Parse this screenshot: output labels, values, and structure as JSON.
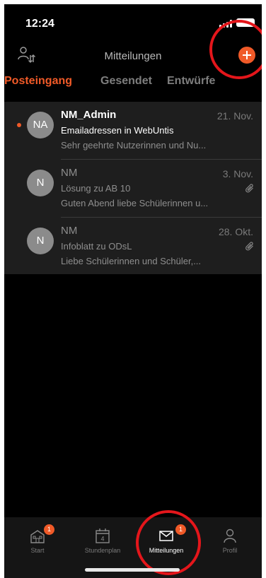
{
  "status_bar": {
    "time": "12:24"
  },
  "header": {
    "title": "Mitteilungen",
    "sort_icon": "sort-person-icon",
    "compose_icon": "plus-icon"
  },
  "tabs": [
    {
      "label": "Posteingang",
      "active": true
    },
    {
      "label": "Gesendet",
      "active": false
    },
    {
      "label": "Entwürfe",
      "active": false
    }
  ],
  "messages": [
    {
      "initials": "NA",
      "sender": "NM_Admin",
      "date": "21. Nov.",
      "subject": "Emailadressen in WebUntis",
      "preview": "Sehr geehrte Nutzerinnen und Nu...",
      "unread": true,
      "attachment": false
    },
    {
      "initials": "N",
      "sender": "NM",
      "date": "3. Nov.",
      "subject": "Lösung zu AB 10",
      "preview": "Guten Abend liebe Schülerinnen u...",
      "unread": false,
      "attachment": true
    },
    {
      "initials": "N",
      "sender": "NM",
      "date": "28. Okt.",
      "subject": "Infoblatt zu ODsL",
      "preview": "Liebe Schülerinnen und Schüler,...",
      "unread": false,
      "attachment": true
    }
  ],
  "tabbar": {
    "start": {
      "label": "Start",
      "badge": "1",
      "icon": "school-icon"
    },
    "stundenplan": {
      "label": "Stundenplan",
      "day": "4",
      "icon": "calendar-icon"
    },
    "mitteilungen": {
      "label": "Mitteilungen",
      "badge": "1",
      "icon": "envelope-icon",
      "active": true
    },
    "profil": {
      "label": "Profil",
      "icon": "person-icon"
    }
  },
  "colors": {
    "accent": "#f05a28",
    "highlight_ring": "#e4161b",
    "background": "#000000",
    "list_background": "#1e1e1e"
  }
}
